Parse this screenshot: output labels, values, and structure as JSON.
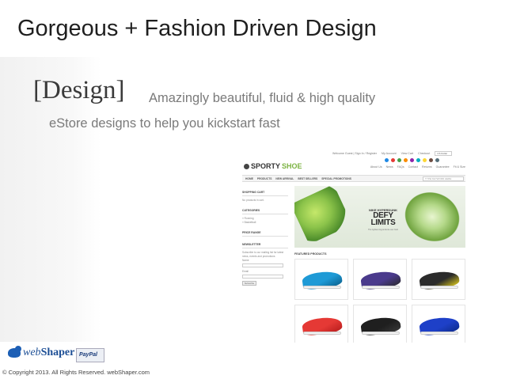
{
  "slide": {
    "title": "Gorgeous + Fashion Driven Design",
    "design_word": "[Design]",
    "design_desc_line1": "Amazingly beautiful, fluid & high quality",
    "design_desc_line2": "eStore designs to help you kickstart fast"
  },
  "mockup": {
    "util_links": [
      "Welcome Guest | Sign In / Register",
      "My Account",
      "View Cart",
      "Checkout"
    ],
    "currency": "US Dollar",
    "swatch_colors": [
      "#1e88e5",
      "#e53935",
      "#43a047",
      "#fb8c00",
      "#8e24aa",
      "#00acc1",
      "#fdd835",
      "#6d4c41",
      "#546e7a"
    ],
    "logo_sporty": "SPORTY",
    "logo_shoe": "SHOE",
    "top_links": [
      "About Us",
      "News",
      "FAQs",
      "Contact",
      "Returns",
      "Guarantee",
      "Fit & Size"
    ],
    "nav_items": [
      "HOME",
      "PRODUCTS",
      "NEW ARRIVAL",
      "BEST SELLERS",
      "SPECIAL PROMOTIONS"
    ],
    "search_placeholder": "TYPE KEYWORD HERE",
    "sidebar": {
      "cart_head": "SHOPPING CART",
      "cart_text": "No products in cart.",
      "categories_head": "CATEGORIES",
      "categories": [
        "» Running",
        "» Basketball"
      ],
      "price_head": "PRICE RANGE",
      "newsletter_head": "NEWSLETTER",
      "newsletter_text": "Subscribe to our mailing list for latest news, events and promotions",
      "name_label": "Name",
      "email_label": "Email",
      "subscribe": "Subscribe"
    },
    "banner": {
      "sub": "NIKE HYPERDUNK",
      "headline_1": "DEFY",
      "headline_2": "LIMITS",
      "note": "The lightest Hyperdunk ever built"
    },
    "featured_head": "FEATURED PRODUCTS",
    "product_colors": [
      {
        "upper": "#1e9ad6",
        "accent": "#0b5f8a"
      },
      {
        "upper": "#4a3a8c",
        "accent": "#2a2a2a"
      },
      {
        "upper": "#2b2b2b",
        "accent": "#e6d21c"
      },
      {
        "upper": "#e53935",
        "accent": "#b71c1c"
      },
      {
        "upper": "#1f1f1f",
        "accent": "#3a3a3a"
      },
      {
        "upper": "#1e40c8",
        "accent": "#0d2a8a"
      }
    ]
  },
  "footer": {
    "brand_prefix": "web",
    "brand_name": "Shaper",
    "paypal": "PayPal",
    "copyright": "© Copyright 2013. All Rights Reserved. webShaper.com"
  }
}
